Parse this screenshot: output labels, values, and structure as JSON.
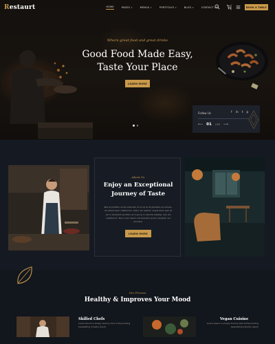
{
  "brand": {
    "logo_initial": "R",
    "logo_rest": "estaurt"
  },
  "nav": {
    "items": [
      {
        "label": "HOME",
        "caret": false
      },
      {
        "label": "PAGES",
        "caret": true
      },
      {
        "label": "MENUS",
        "caret": true
      },
      {
        "label": "PORTFOLIO",
        "caret": true
      },
      {
        "label": "BLOG",
        "caret": true
      },
      {
        "label": "CONTACT US",
        "caret": false
      }
    ],
    "book_label": "BOOK A TABLE"
  },
  "hero": {
    "subtitle": "Where great food and great drinks",
    "title_line1": "Good Food Made Easy,",
    "title_line2": "Taste Your Place",
    "button_label": "LEARN MORE",
    "slide_current": "01",
    "slide_total": "/ 03",
    "follow_label": "Follow Us",
    "social": [
      "f",
      "in",
      "t",
      "p"
    ]
  },
  "about": {
    "subtitle": "About Us",
    "title_line1": "Enjoy an Exceptional",
    "title_line2": "Journey of Taste",
    "text": "Red at porttitor endre ante sibi ut ut vit ut nb pharetra accumsan. At ullamcorper vestibulum, tellus nec aptent, neque diam quis at dui in hendrerit porttitor at in purus in lobortis habitae. hen dui vestibulum. Nunc nam ipsum nsh pharetra quam volutpat, vel posuere.",
    "button_label": "LEARN MORE"
  },
  "services": {
    "subtitle": "Our Process",
    "title": "Healthy & Improves Your Mood",
    "items": [
      {
        "name": "Skilled Chefs",
        "text": "Lorem Ipsum is simply dummy text of the printing typesetting industry ipsum"
      },
      {
        "name": "Vegan Cuisine",
        "text": "Lorem Ipsum is simply dummy text of the printing typesetting industry ipsum"
      }
    ]
  },
  "colors": {
    "accent": "#c99a4b",
    "background": "#12161d",
    "panel": "#1e232c"
  },
  "icons": [
    "search-icon",
    "cart-icon",
    "menu-icon",
    "facebook-icon",
    "twitter-icon",
    "instagram-icon",
    "leaf-icon"
  ]
}
